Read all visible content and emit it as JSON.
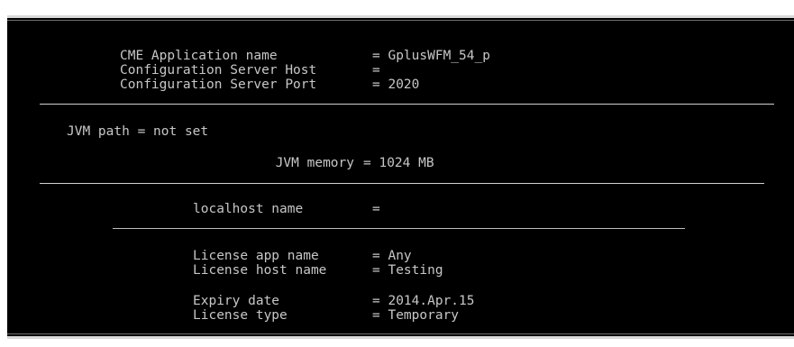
{
  "cme_block": {
    "app_name_label": "CME Application name",
    "app_name_eq": "= GplusWFM_54_p",
    "host_label": "Configuration Server Host",
    "host_eq": "=",
    "port_label": "Configuration Server Port",
    "port_eq": "= 2020"
  },
  "jvm_block": {
    "path_text": "JVM path = not set",
    "memory_label": "JVM memory",
    "memory_eq": "= 1024 MB"
  },
  "localhost_block": {
    "label": "localhost name",
    "eq": "="
  },
  "license_block": {
    "app_label": "License app name",
    "app_eq": "= Any",
    "host_label": "License host name",
    "host_eq": "= Testing",
    "expiry_label": "Expiry date",
    "expiry_eq": "= 2014.Apr.15",
    "type_label": "License type",
    "type_eq": "= Temporary"
  }
}
